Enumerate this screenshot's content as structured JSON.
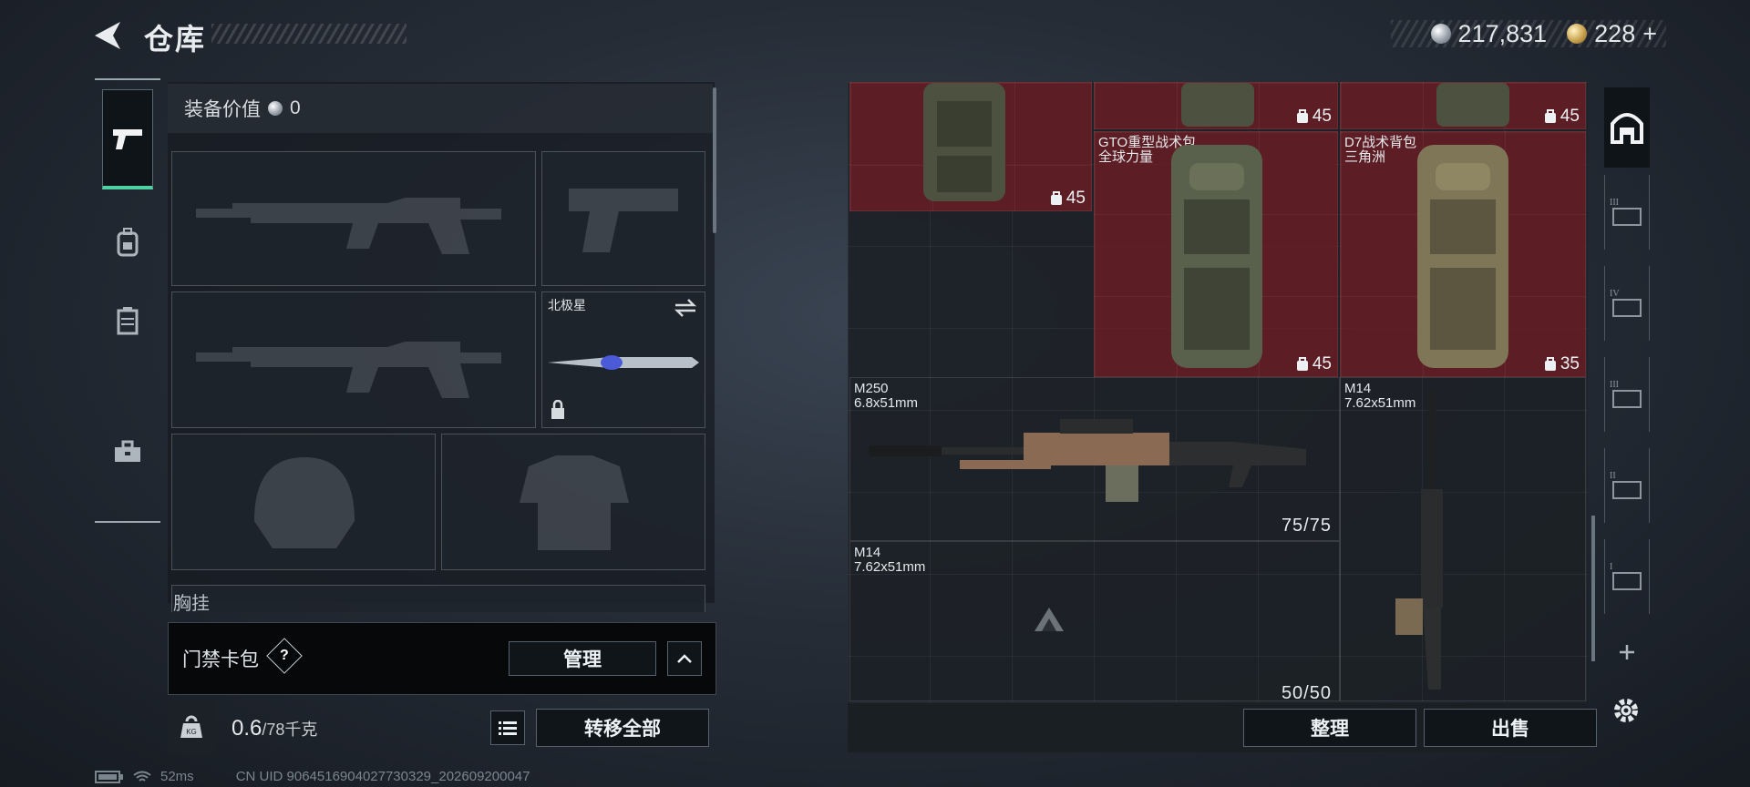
{
  "header": {
    "title": "仓库",
    "currency": {
      "silver_amount": "217,831",
      "gold_amount": "228",
      "gold_plus": "+"
    }
  },
  "loadout": {
    "equip_value_label": "装备价值",
    "equip_value": "0",
    "melee_slot_label": "北极星",
    "chest_label": "胸挂"
  },
  "card_pack": {
    "label": "门禁卡包",
    "help": "?",
    "manage_label": "管理"
  },
  "weight": {
    "current": "0.6",
    "capacity": "/78千克",
    "kg_label": "KG",
    "transfer_all_label": "转移全部"
  },
  "status": {
    "ping": "52ms",
    "uid": "CN UID 9064516904027730329_202609200047"
  },
  "inventory": {
    "items": [
      {
        "name": "",
        "sub": "",
        "badge": "45"
      },
      {
        "name": "",
        "sub": "",
        "badge": "45"
      },
      {
        "name": "",
        "sub": "",
        "badge": "45"
      },
      {
        "name": "GTO重型战术包",
        "sub": "全球力量",
        "badge": "45"
      },
      {
        "name": "D7战术背包",
        "sub": "三角洲",
        "badge": "35"
      }
    ],
    "weapons": [
      {
        "name": "M250",
        "caliber": "6.8x51mm",
        "ammo": "75/75"
      },
      {
        "name": "M14",
        "caliber": "7.62x51mm",
        "ammo": ""
      },
      {
        "name": "M14",
        "caliber": "7.62x51mm",
        "ammo": "50/50"
      }
    ],
    "organize_label": "整理",
    "sell_label": "出售"
  },
  "right_tabs": [
    "III",
    "IV",
    "III",
    "II",
    "I"
  ],
  "colors": {
    "accent_green": "#4fd0a2",
    "danger_red": "#6e1c24"
  }
}
